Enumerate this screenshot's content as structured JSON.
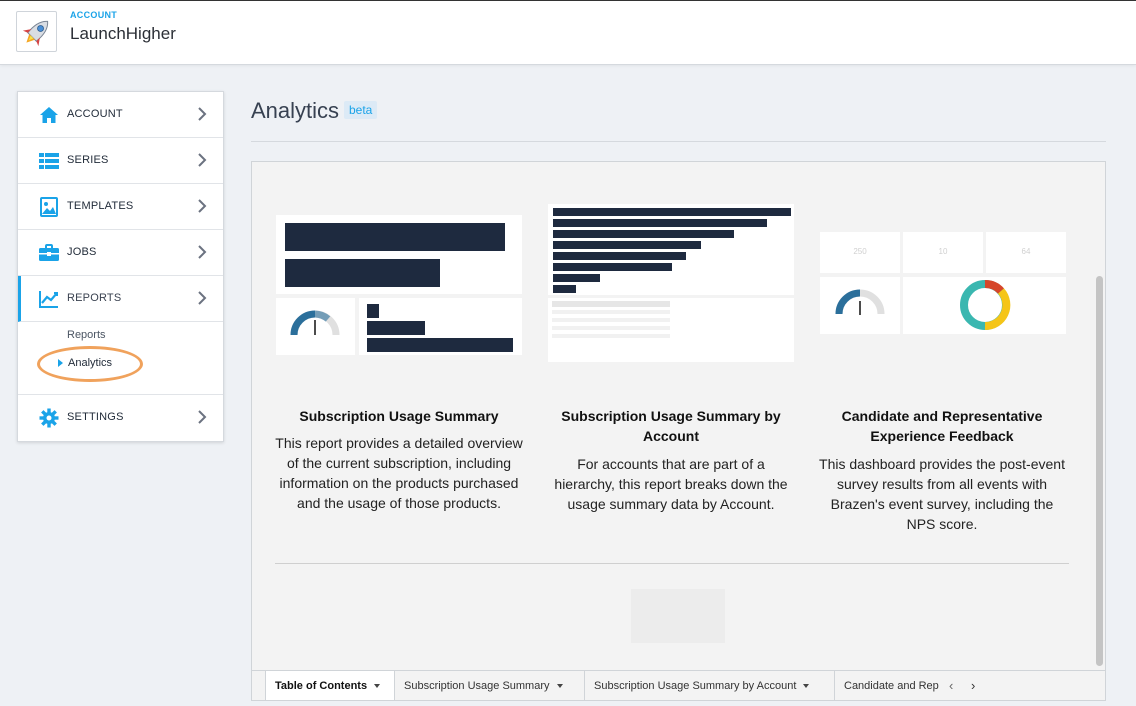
{
  "header": {
    "account_label": "ACCOUNT",
    "account_name": "LaunchHigher",
    "logo_icon": "rocket-icon"
  },
  "sidebar": {
    "items": [
      {
        "label": "ACCOUNT",
        "icon": "home-icon"
      },
      {
        "label": "SERIES",
        "icon": "list-icon"
      },
      {
        "label": "TEMPLATES",
        "icon": "image-icon"
      },
      {
        "label": "JOBS",
        "icon": "briefcase-icon"
      },
      {
        "label": "REPORTS",
        "icon": "chart-line-icon"
      },
      {
        "label": "SETTINGS",
        "icon": "gear-icon"
      }
    ],
    "reports_sub": {
      "reports": "Reports",
      "analytics": "Analytics"
    }
  },
  "page": {
    "title": "Analytics",
    "badge": "beta"
  },
  "cards": [
    {
      "title": "Subscription Usage Summary",
      "description": "This report provides a detailed overview of the current subscription, including information on the products purchased and the usage of those products."
    },
    {
      "title": "Subscription Usage Summary by Account",
      "description": "For accounts that are part of a hierarchy, this report breaks down the usage summary data by Account."
    },
    {
      "title": "Candidate and Representative Experience Feedback",
      "description": "This dashboard provides the post-event survey results from all events with Brazen's event survey, including the NPS score."
    }
  ],
  "thumb_kpis": [
    "250",
    "10",
    "64"
  ],
  "tabs": [
    {
      "label": "Table of Contents",
      "active": true
    },
    {
      "label": "Subscription Usage Summary",
      "active": false
    },
    {
      "label": "Subscription Usage Summary by Account",
      "active": false
    },
    {
      "label": "Candidate and Representative Experience Feedback",
      "active": false
    }
  ],
  "colors": {
    "accent": "#1aa3e8",
    "navy": "#1e2a3f",
    "highlight_ring": "#f0a25c",
    "donut_teal": "#3ab7b0",
    "donut_yellow": "#f5c518",
    "donut_red": "#d6462a"
  }
}
